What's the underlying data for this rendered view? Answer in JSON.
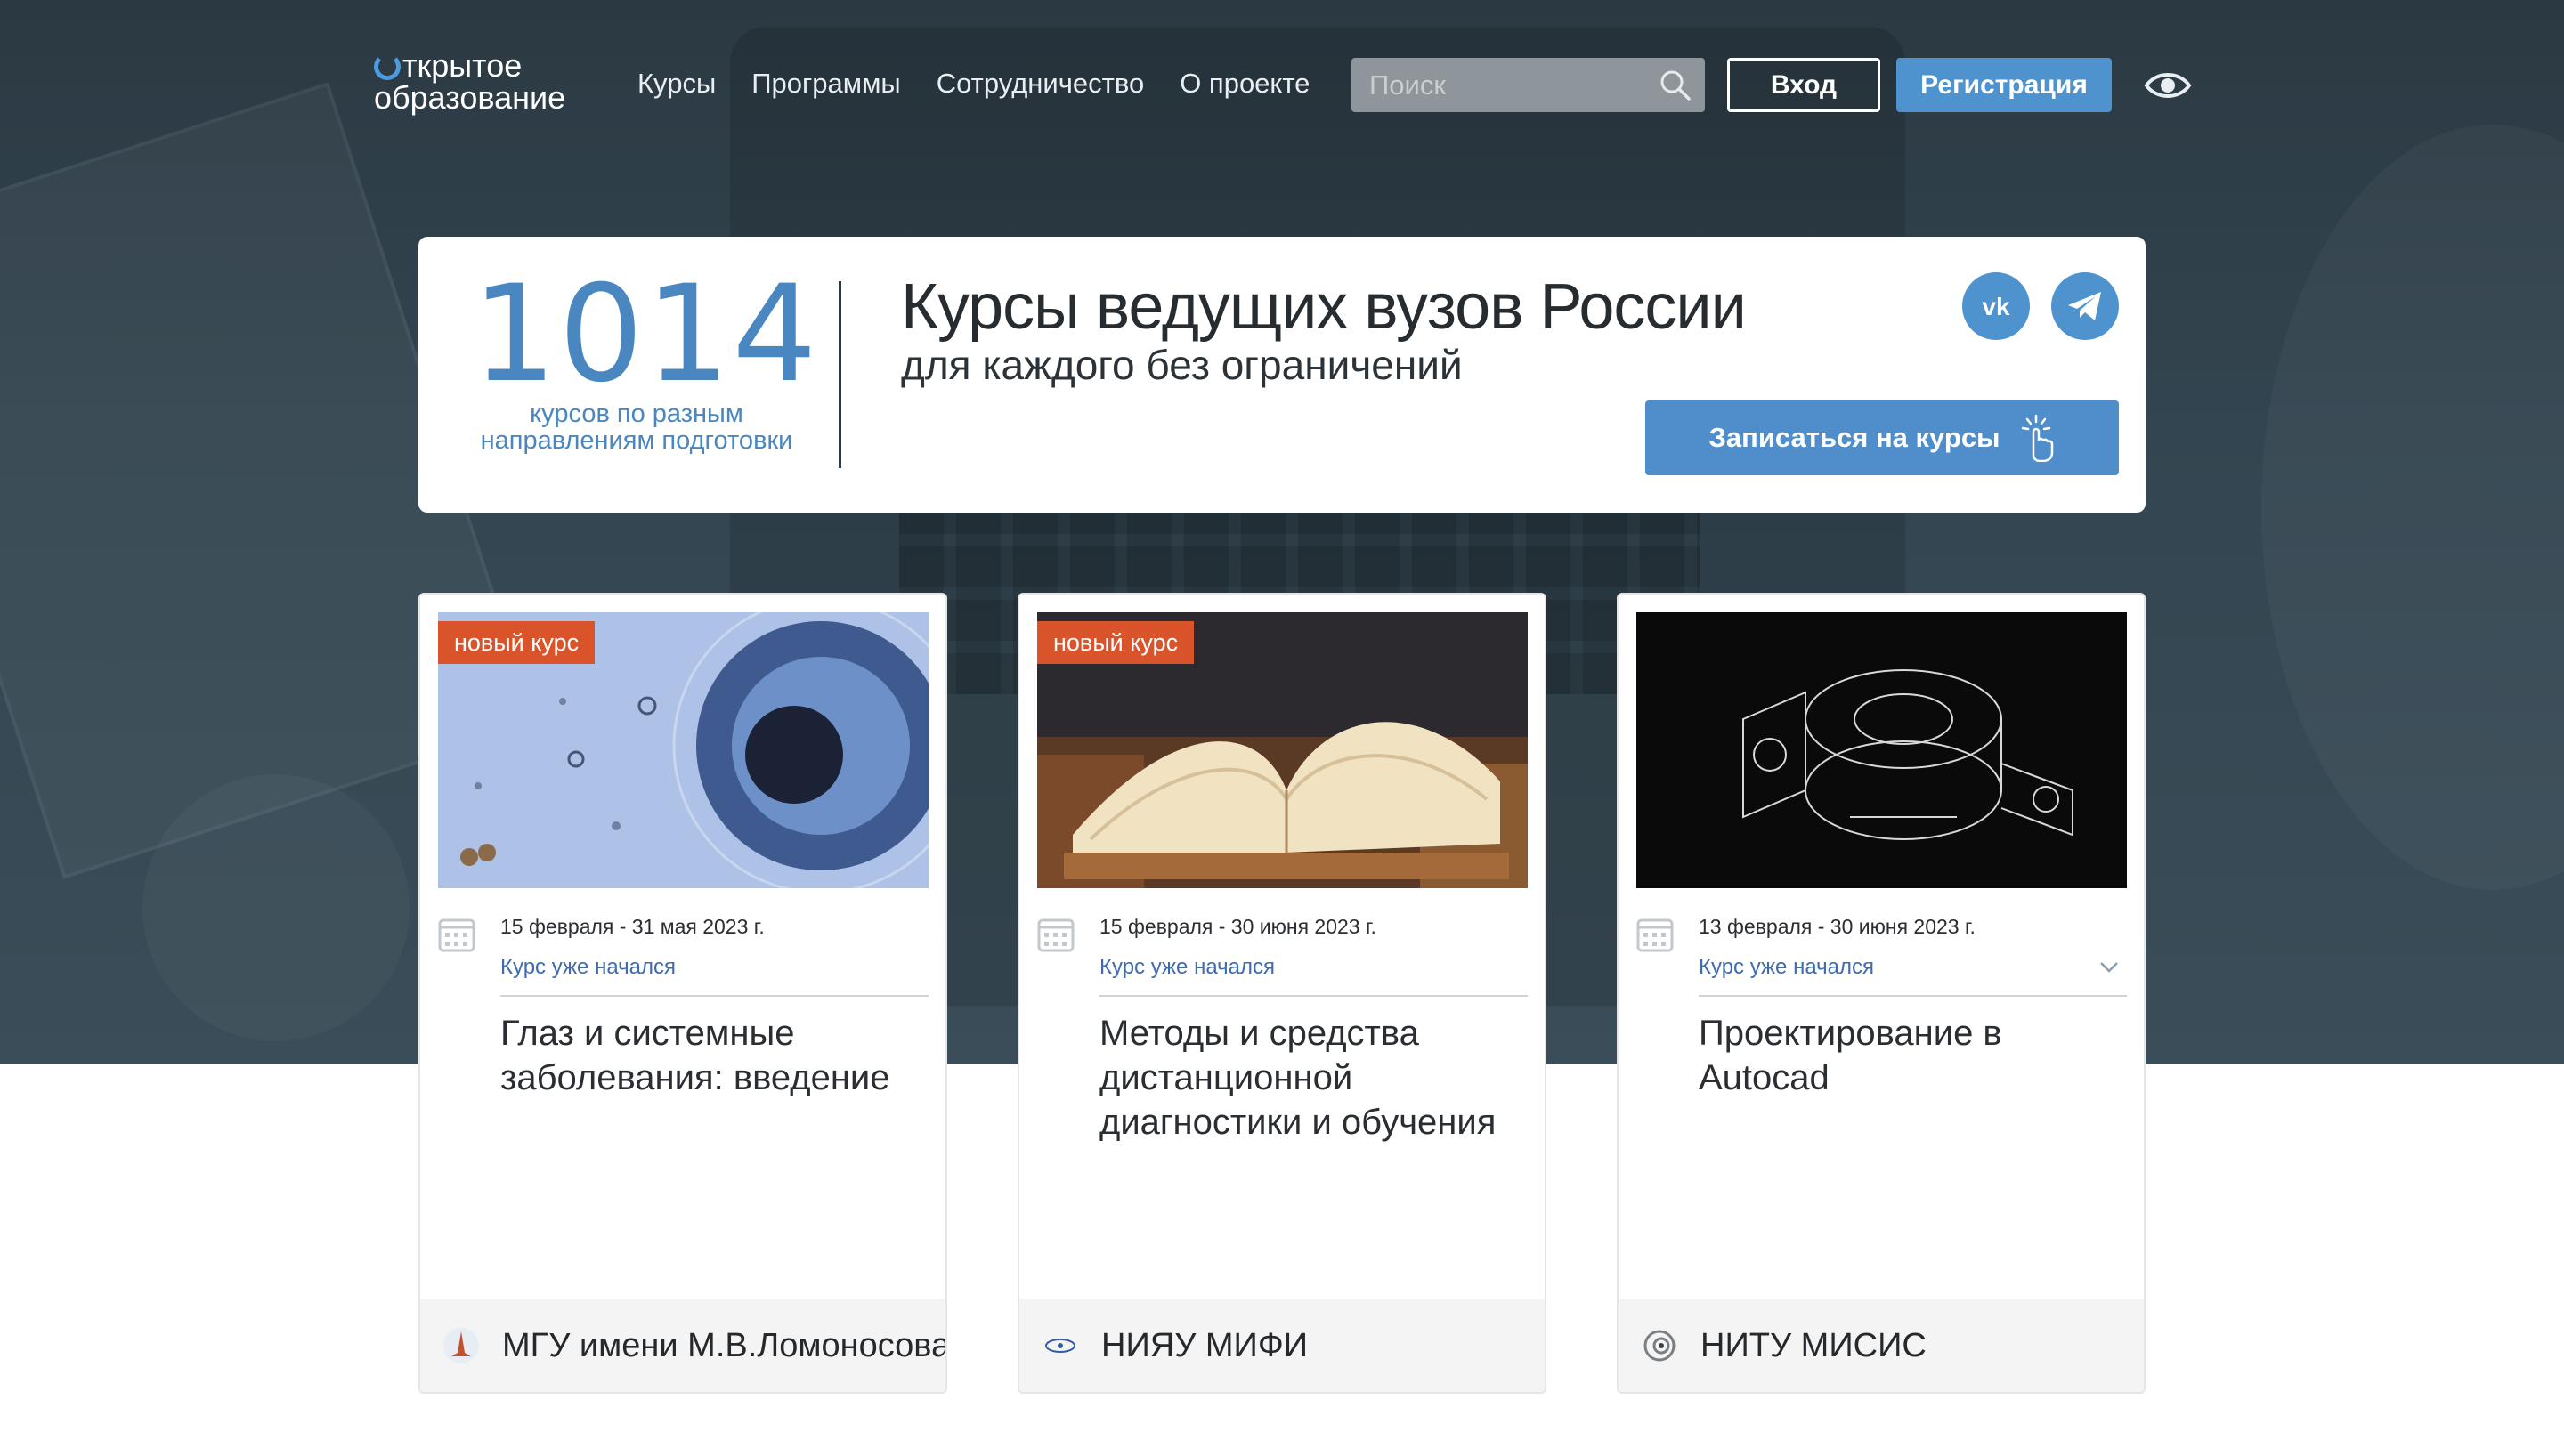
{
  "header": {
    "logo_line1": "ткрытое",
    "logo_line2": "образование",
    "nav": [
      "Курсы",
      "Программы",
      "Сотрудничество",
      "О проекте"
    ],
    "search_placeholder": "Поиск",
    "login_label": "Вход",
    "register_label": "Регистрация",
    "icons": {
      "search": "search-icon",
      "accessibility": "eye-icon"
    }
  },
  "banner": {
    "count": "1014",
    "count_caption_line1": "курсов по разным",
    "count_caption_line2": "направлениям подготовки",
    "title": "Курсы ведущих вузов России",
    "subtitle": "для каждого без ограничений",
    "enroll_label": "Записаться на курсы",
    "social": [
      "vk-icon",
      "telegram-icon"
    ]
  },
  "cards": [
    {
      "badge": "новый курс",
      "dates": "15 февраля - 31 мая 2023 г.",
      "status": "Курс уже начался",
      "title": "Глаз и системные заболевания: введение",
      "university": "МГУ имени М.В.Ломоносова"
    },
    {
      "badge": "новый курс",
      "dates": "15 февраля - 30 июня 2023 г.",
      "status": "Курс уже начался",
      "title": "Методы и средства дистанционной диагностики и обучения",
      "university": "НИЯУ МИФИ"
    },
    {
      "dates": "13 февраля - 30 июня 2023 г.",
      "status": "Курс уже начался",
      "title": "Проектирование в Autocad",
      "university": "НИТУ МИСИС"
    }
  ],
  "colors": {
    "accent": "#4f93ce",
    "badge": "#d9532b",
    "hero_bg": "#334550",
    "status_link": "#3f6bb0"
  }
}
